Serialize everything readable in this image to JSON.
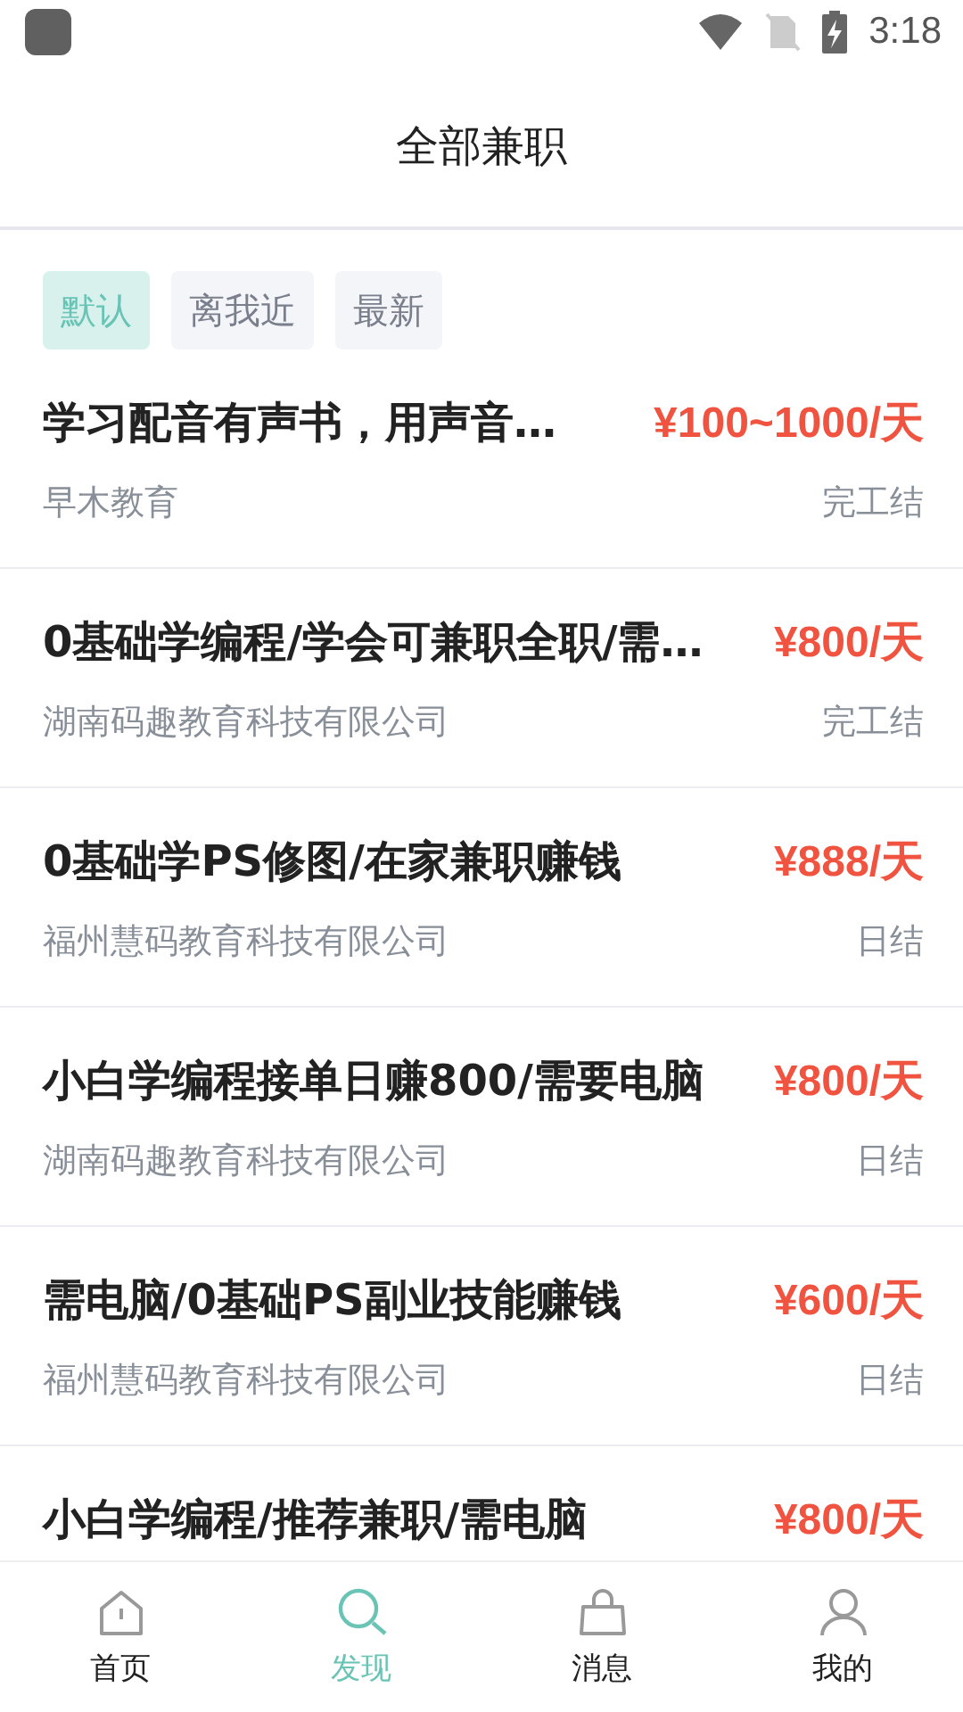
{
  "status_bar": {
    "time": "3:18"
  },
  "header": {
    "title": "全部兼职"
  },
  "filters": [
    {
      "label": "默认",
      "selected": true
    },
    {
      "label": "离我近",
      "selected": false
    },
    {
      "label": "最新",
      "selected": false
    }
  ],
  "jobs": [
    {
      "title": "学习配音有声书，用声音…",
      "pay": "¥100~1000/天",
      "company": "早木教育",
      "settlement": "完工结"
    },
    {
      "title": "0基础学编程/学会可兼职全职/需…",
      "pay": "¥800/天",
      "company": "湖南码趣教育科技有限公司",
      "settlement": "完工结"
    },
    {
      "title": "0基础学PS修图/在家兼职赚钱",
      "pay": "¥888/天",
      "company": "福州慧码教育科技有限公司",
      "settlement": "日结"
    },
    {
      "title": "小白学编程接单日赚800/需要电脑",
      "pay": "¥800/天",
      "company": "湖南码趣教育科技有限公司",
      "settlement": "日结"
    },
    {
      "title": "需电脑/0基础PS副业技能赚钱",
      "pay": "¥600/天",
      "company": "福州慧码教育科技有限公司",
      "settlement": "日结"
    },
    {
      "title": "小白学编程/推荐兼职/需电脑",
      "pay": "¥800/天"
    }
  ],
  "tab_bar": [
    {
      "label": "首页",
      "kind": "home",
      "selected": false
    },
    {
      "label": "发现",
      "kind": "search",
      "selected": true
    },
    {
      "label": "消息",
      "kind": "bag",
      "selected": false
    },
    {
      "label": "我的",
      "kind": "person",
      "selected": false
    }
  ]
}
